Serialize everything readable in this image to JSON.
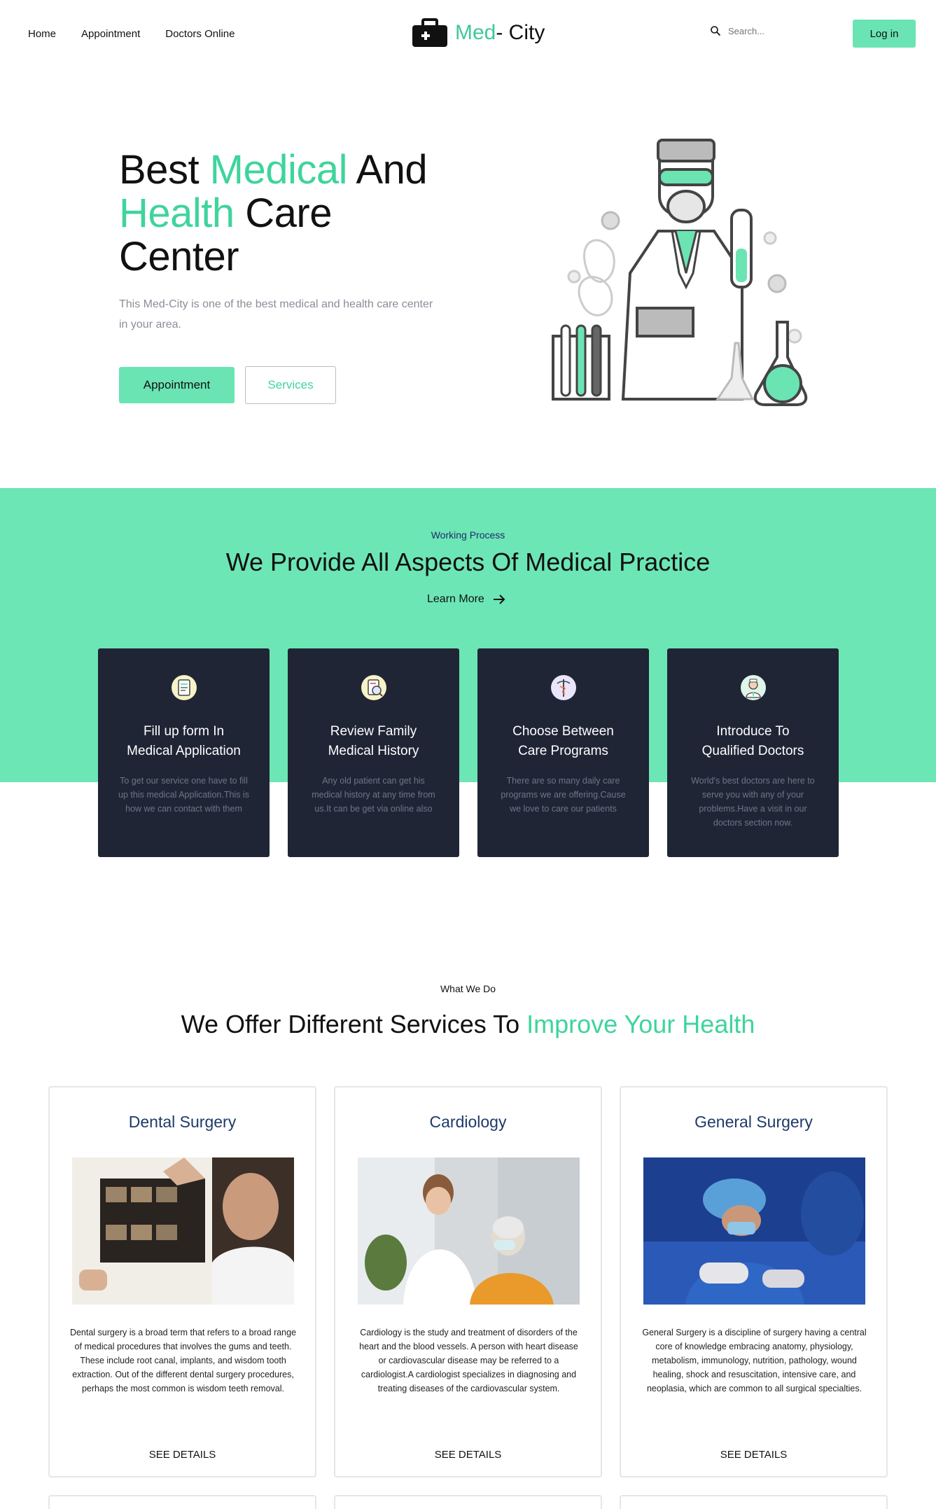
{
  "nav": {
    "links": [
      "Home",
      "Appointment",
      "Doctors Online"
    ],
    "brand_part1": "Med",
    "brand_part2": "- City",
    "search_placeholder": "Search...",
    "login": "Log in"
  },
  "hero": {
    "title_w1": "Best ",
    "title_w2": "Medical",
    "title_w3": " And",
    "title_w4": "Health",
    "title_w5": " Care",
    "title_w6": "Center",
    "description": "This Med-City is one of the best medical and health care center in your area.",
    "appointment_button": "Appointment",
    "services_button": "Services"
  },
  "process": {
    "eyebrow": "Working Process",
    "title": "We Provide All Aspects Of Medical Practice",
    "learn_more": "Learn More",
    "cards": [
      {
        "title1": "Fill up form In",
        "title2": "Medical Application",
        "text": "To get our service one have to fill up this medical Application.This is how we can contact with them"
      },
      {
        "title1": "Review Family",
        "title2": "Medical History",
        "text": "Any old patient can get his medical history at any time from us.It can be get via online also"
      },
      {
        "title1": "Choose Between",
        "title2": "Care Programs",
        "text": "There are so many daily care programs we are offering.Cause we love to care our patients"
      },
      {
        "title1": "Introduce To",
        "title2": "Qualified Doctors",
        "text": "World's best doctors are here to serve you with any of your problems.Have a visit in our doctors section now."
      }
    ]
  },
  "services": {
    "eyebrow": "What We Do",
    "title_part1": "We Offer Different Services To ",
    "title_part2": "Improve Your Health",
    "cards": [
      {
        "title": "Dental Surgery",
        "text": "Dental surgery is a broad term that refers to a broad range of medical procedures that involves the gums and teeth. These include root canal, implants, and wisdom tooth extraction. Out of the different dental surgery procedures, perhaps the most common is wisdom teeth removal.",
        "details": "SEE DETAILS"
      },
      {
        "title": "Cardiology",
        "text": "Cardiology is the study and treatment of disorders of the heart and the blood vessels. A person with heart disease or cardiovascular disease may be referred to a cardiologist.A cardiologist specializes in diagnosing and treating diseases of the cardiovascular system.",
        "details": "SEE DETAILS"
      },
      {
        "title": "General Surgery",
        "text": "General Surgery is a discipline of surgery having a central core of knowledge embracing anatomy, physiology, metabolism, immunology, nutrition, pathology, wound healing, shock and resuscitation, intensive care, and neoplasia, which are common to all surgical specialties.",
        "details": "SEE DETAILS"
      }
    ]
  }
}
